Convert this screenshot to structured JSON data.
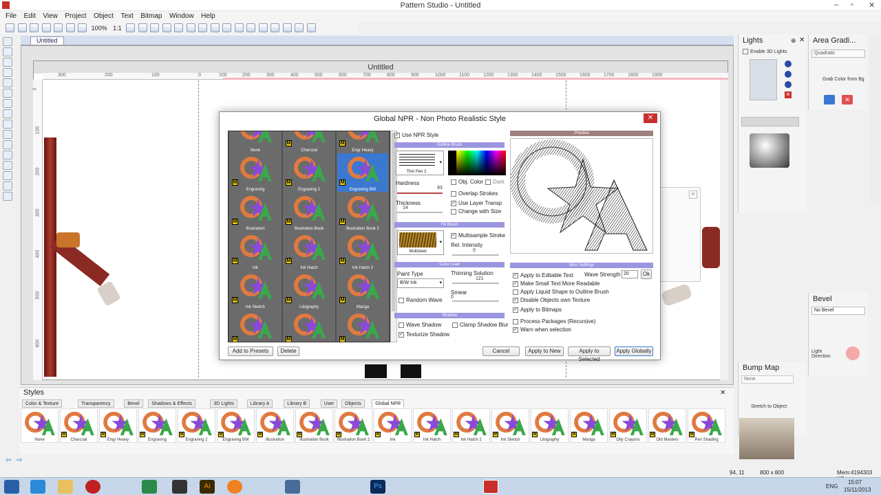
{
  "app": {
    "title": "Pattern Studio - Untitled",
    "doc_tab": "Untitled",
    "canvas_title": "Untitled"
  },
  "menu": [
    "File",
    "Edit",
    "View",
    "Project",
    "Object",
    "Text",
    "Bitmap",
    "Window",
    "Help"
  ],
  "toolbar": {
    "zoom": "100%",
    "ratio": "1:1"
  },
  "ruler": {
    "h_ticks": [
      "300",
      "200",
      "100",
      "0",
      "100",
      "200",
      "300",
      "400",
      "500",
      "600",
      "700",
      "800",
      "900",
      "1000",
      "1100",
      "1200",
      "1300",
      "1400",
      "1500",
      "1600",
      "1700",
      "1800",
      "1900"
    ],
    "v_ticks": [
      "0",
      "100",
      "200",
      "300",
      "400",
      "500",
      "600"
    ]
  },
  "dialog": {
    "title": "Global NPR - Non Photo Realistic Style",
    "presets": [
      {
        "name": "None",
        "m": false,
        "sel": false
      },
      {
        "name": "Charcoal",
        "m": true,
        "sel": false
      },
      {
        "name": "Engr Heavy",
        "m": true,
        "sel": false
      },
      {
        "name": "Engraving",
        "m": true,
        "sel": false
      },
      {
        "name": "Engraving 2",
        "m": true,
        "sel": false
      },
      {
        "name": "Engraving BW",
        "m": true,
        "sel": true
      },
      {
        "name": "Illustration",
        "m": true,
        "sel": false
      },
      {
        "name": "Illustration Book",
        "m": true,
        "sel": false
      },
      {
        "name": "Illustration Book 2",
        "m": true,
        "sel": false
      },
      {
        "name": "Ink",
        "m": true,
        "sel": false
      },
      {
        "name": "Ink Hatch",
        "m": true,
        "sel": false
      },
      {
        "name": "Ink Hatch 2",
        "m": true,
        "sel": false
      },
      {
        "name": "Ink Sketch",
        "m": true,
        "sel": false
      },
      {
        "name": "Litography",
        "m": true,
        "sel": false
      },
      {
        "name": "Manga",
        "m": true,
        "sel": false
      },
      {
        "name": "Oily Crayons",
        "m": true,
        "sel": false
      },
      {
        "name": "Old Masters",
        "m": true,
        "sel": false
      },
      {
        "name": "Pen Shading",
        "m": true,
        "sel": false
      }
    ],
    "use_npr": "Use NPR Style",
    "outline_brush": "Outline Brush",
    "brush_name": "Thin Pen 2",
    "hardness_label": "Hardness",
    "hardness_value": "93",
    "thickness_label": "Thickness",
    "thickness_value": "14",
    "obj_color": "Obj. Color",
    "dark": "Dark",
    "overlap": "Overlap Strokes",
    "layer_transp": "Use Layer Transp",
    "change_size": "Change with Size",
    "fill_brush": "Fill Brush",
    "fill_name": "Multisteel",
    "multisample": "Multisample Stroke",
    "rel_intensity": "Rel. Intensity",
    "rel_value": "0",
    "color_load": "Color Load",
    "paint_type_label": "Paint Type",
    "paint_type": "B/W Ink",
    "thinning_label": "Thinning Solution",
    "thinning_value": "121",
    "smear_label": "Smear",
    "smear_value": "0",
    "random_wave": "Random Wave",
    "shadow": "Shadow",
    "wave_shadow": "Wave Shadow",
    "clamp_shadow": "Clamp Shadow Blur",
    "texturize_shadow": "Texturize Shadow",
    "preview": "Preview",
    "misc": "Misc Settings",
    "apply_editable": "Apply to Editable Text",
    "wave_strength_label": "Wave Strength",
    "wave_strength": "20",
    "ok": "Ok",
    "small_text": "Make Small Text More Readable",
    "liquid_shape": "Apply Liquid Shape to Outline Brush",
    "disable_texture": "Disable Objects own Texture",
    "apply_bitmaps": "Apply to Bitmaps",
    "process_packages": "Process Packages (Recursive)",
    "warn_selection": "Warn when selection",
    "buttons": {
      "add": "Add to Presets",
      "delete": "Delete",
      "cancel": "Cancel",
      "apply_new": "Apply to New",
      "apply_selected": "Apply to Selected",
      "apply_globally": "Apply Globally"
    }
  },
  "panels": {
    "lights": {
      "title": "Lights",
      "enable": "Enable 3D Lights"
    },
    "area_gradient": {
      "title": "Area Gradi...",
      "type": "Quadratic",
      "grab": "Grab Color from Bg"
    },
    "bevel": {
      "title": "Bevel",
      "value": "No Bevel",
      "light_dir": "Light Direction"
    },
    "bump_map": {
      "title": "Bump Map",
      "value": "None",
      "stretch": "Stretch to Object"
    }
  },
  "styles": {
    "title": "Styles",
    "tabs": [
      "Color & Texture",
      "Transparency",
      "Bevel",
      "Shadows & Effects",
      "3D Lights",
      "Library A",
      "Library B",
      "User",
      "Objects",
      "Global NPR"
    ],
    "active_tab": "Global NPR",
    "items": [
      "None",
      "Charcoal",
      "Engr Heavy",
      "Engraving",
      "Engraving 2",
      "Engraving BW",
      "Illustration",
      "Illustration Book",
      "Illustration Book 2",
      "Ink",
      "Ink Hatch",
      "Ink Hatch 2",
      "Ink Sketch",
      "Litography",
      "Manga",
      "Oily Crayons",
      "Old Masters",
      "Pen Shading"
    ]
  },
  "status": {
    "coords": "94, 11",
    "size": "800 x 800",
    "mem": "Mem:4194303 KB"
  },
  "taskbar": {
    "time": "15:07",
    "date": "15/11/2013",
    "lang": "ENG"
  },
  "colors": {
    "accent_blue": "#3b78d0",
    "section_bar": "#9b96e0",
    "close_red": "#c8302b"
  }
}
